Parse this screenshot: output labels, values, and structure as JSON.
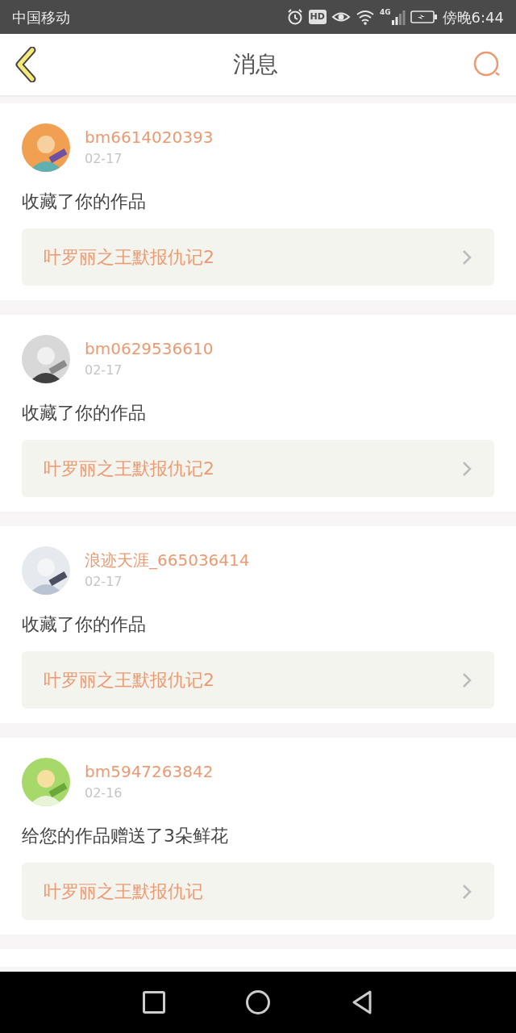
{
  "status_bar": {
    "carrier": "中国移动",
    "hd_label": "HD",
    "network_label": "4G",
    "time": "傍晚6:44"
  },
  "header": {
    "title": "消息"
  },
  "messages": [
    {
      "user": "bm6614020393",
      "date": "02-17",
      "text": "收藏了你的作品",
      "work": "叶罗丽之王默报仇记2"
    },
    {
      "user": "bm0629536610",
      "date": "02-17",
      "text": "收藏了你的作品",
      "work": "叶罗丽之王默报仇记2"
    },
    {
      "user": "浪迹天涯_665036414",
      "date": "02-17",
      "text": "收藏了你的作品",
      "work": "叶罗丽之王默报仇记2"
    },
    {
      "user": "bm5947263842",
      "date": "02-16",
      "text": "给您的作品赠送了3朵鲜花",
      "work": "叶罗丽之王默报仇记"
    }
  ]
}
